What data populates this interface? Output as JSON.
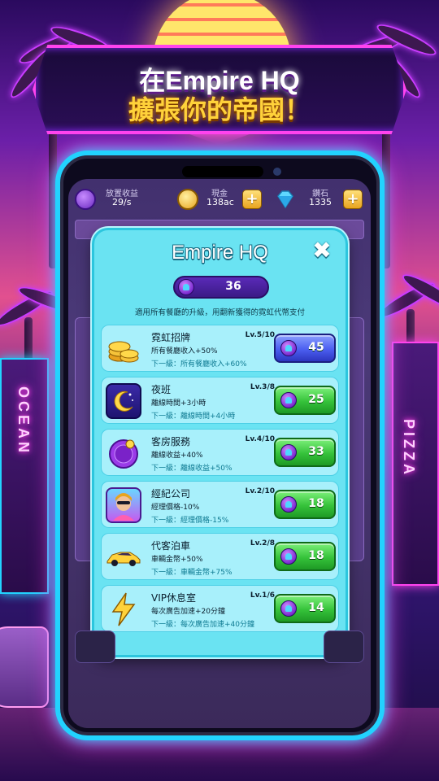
{
  "banner": {
    "line1": "在Empire HQ",
    "line2": "擴張你的帝國！"
  },
  "hud": {
    "idle": {
      "label": "放置收益",
      "value": "29/s",
      "icon": "clock-coin-icon"
    },
    "cash": {
      "label": "現金",
      "value": "138ac",
      "icon": "gold-coin-icon"
    },
    "gems": {
      "label": "鑽石",
      "value": "1335",
      "icon": "diamond-icon"
    },
    "plus": "+"
  },
  "modal": {
    "title": "Empire HQ",
    "close": "✖",
    "balance": "36",
    "hint": "適用所有餐廳的升級，用翻新獲得的霓虹代幣支付"
  },
  "upgrades": [
    {
      "name": "霓虹招牌",
      "level": "Lv.5/10",
      "effect": "所有餐廳收入+50%",
      "next": "下一級：所有餐廳收入+60%",
      "price": "45",
      "button": "blue",
      "icon": "gold-coins-icon"
    },
    {
      "name": "夜班",
      "level": "Lv.3/8",
      "effect": "離線時間+3小時",
      "next": "下一級：離線時間+4小時",
      "price": "25",
      "button": "green",
      "icon": "moon-icon"
    },
    {
      "name": "客房服務",
      "level": "Lv.4/10",
      "effect": "離線收益+40%",
      "next": "下一級：離線收益+50%",
      "price": "33",
      "button": "green",
      "icon": "room-service-icon"
    },
    {
      "name": "經紀公司",
      "level": "Lv.2/10",
      "effect": "經理價格-10%",
      "next": "下一級：經理價格-15%",
      "price": "18",
      "button": "green",
      "icon": "manager-portrait-icon"
    },
    {
      "name": "代客泊車",
      "level": "Lv.2/8",
      "effect": "車輛金幣+50%",
      "next": "下一級：車輛金幣+75%",
      "price": "18",
      "button": "green",
      "icon": "sports-car-icon"
    },
    {
      "name": "VIP休息室",
      "level": "Lv.1/6",
      "effect": "每次廣告加速+20分鐘",
      "next": "下一級：每次廣告加速+40分鐘",
      "price": "14",
      "button": "green",
      "icon": "lightning-icon"
    }
  ],
  "background": {
    "sign_left": "OCEAN",
    "sign_right": "PIZZA"
  },
  "colors": {
    "modal_bg": "#6ae3f2",
    "card_bg": "#a8f0fb",
    "neon_pink": "#ff44ee",
    "neon_cyan": "#22d3ff",
    "green_button": "#35c23a",
    "blue_button": "#4b5ef0"
  }
}
